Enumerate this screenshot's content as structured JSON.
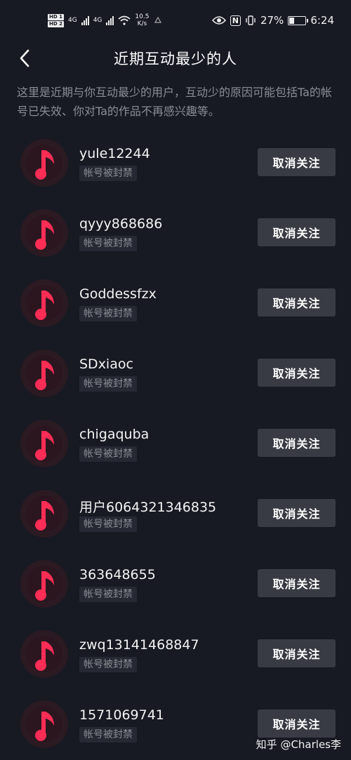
{
  "status_bar": {
    "hd1": "HD 1",
    "hd2": "HD 2",
    "net1": "4G",
    "net2": "4G",
    "speed_value": "10.5",
    "speed_unit": "K/s",
    "battery_text": "27%",
    "battery_level": 0.27,
    "time": "6:24",
    "nfc_label": "N"
  },
  "header": {
    "title": "近期互动最少的人",
    "back_icon": "chevron-left-icon"
  },
  "description": "这里是近期与你互动最少的用户，互动少的原因可能包括Ta的帐号已失效、你对Ta的作品不再感兴趣等。",
  "users": [
    {
      "name": "yule12244",
      "tag": "帐号被封禁",
      "button": "取消关注"
    },
    {
      "name": "qyyy868686",
      "tag": "帐号被封禁",
      "button": "取消关注"
    },
    {
      "name": "Goddessfzx",
      "tag": "帐号被封禁",
      "button": "取消关注"
    },
    {
      "name": "SDxiaoc",
      "tag": "帐号被封禁",
      "button": "取消关注"
    },
    {
      "name": "chigaquba",
      "tag": "帐号被封禁",
      "button": "取消关注"
    },
    {
      "name": "用户6064321346835",
      "tag": "帐号被封禁",
      "button": "取消关注"
    },
    {
      "name": "363648655",
      "tag": "帐号被封禁",
      "button": "取消关注"
    },
    {
      "name": "zwq13141468847",
      "tag": "帐号被封禁",
      "button": "取消关注"
    },
    {
      "name": "1571069741",
      "tag": "帐号被封禁",
      "button": "取消关注"
    }
  ],
  "watermark": "知乎 @Charles李",
  "colors": {
    "background": "#171923",
    "button_bg": "#393b44",
    "accent": "#ff2d55"
  }
}
